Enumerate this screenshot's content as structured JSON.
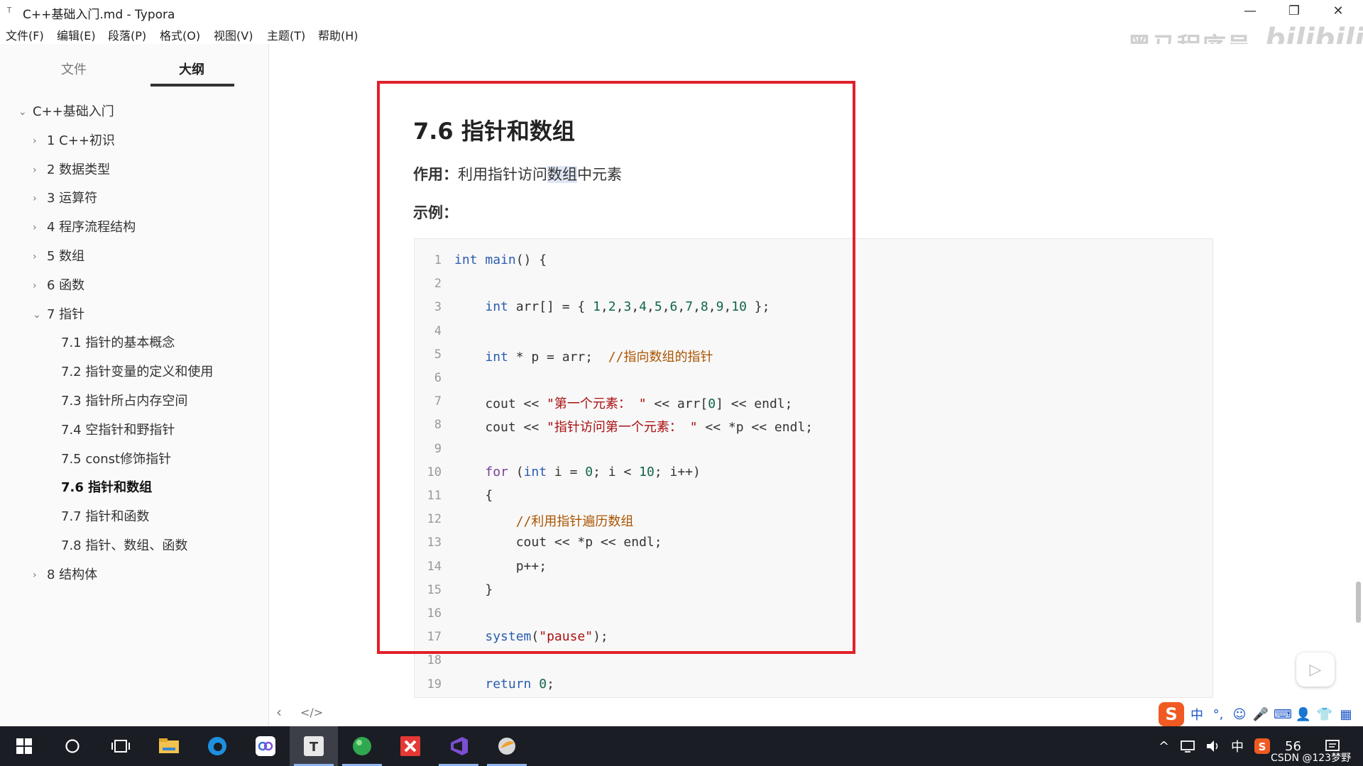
{
  "window": {
    "app_icon": "T",
    "title": "C++基础入门.md - Typora",
    "minimize": "—",
    "maximize": "❐",
    "close": "✕"
  },
  "menu": [
    "文件(F)",
    "编辑(E)",
    "段落(P)",
    "格式(O)",
    "视图(V)",
    "主题(T)",
    "帮助(H)"
  ],
  "watermark": {
    "text": "黑马程序员-",
    "logo": "bilibili"
  },
  "sidebar": {
    "tabs": [
      "文件",
      "大纲"
    ],
    "active_tab": "大纲",
    "outline": [
      {
        "label": "C++基础入门",
        "caret": "⌄",
        "level": 0
      },
      {
        "label": "1 C++初识",
        "caret": "›",
        "level": 1
      },
      {
        "label": "2 数据类型",
        "caret": "›",
        "level": 1
      },
      {
        "label": "3 运算符",
        "caret": "›",
        "level": 1
      },
      {
        "label": "4 程序流程结构",
        "caret": "›",
        "level": 1
      },
      {
        "label": "5 数组",
        "caret": "›",
        "level": 1
      },
      {
        "label": "6 函数",
        "caret": "›",
        "level": 1
      },
      {
        "label": "7 指针",
        "caret": "⌄",
        "level": 1
      },
      {
        "label": "7.1 指针的基本概念",
        "caret": "",
        "level": 2
      },
      {
        "label": "7.2 指针变量的定义和使用",
        "caret": "",
        "level": 2
      },
      {
        "label": "7.3 指针所占内存空间",
        "caret": "",
        "level": 2
      },
      {
        "label": "7.4 空指针和野指针",
        "caret": "",
        "level": 2
      },
      {
        "label": "7.5 const修饰指针",
        "caret": "",
        "level": 2
      },
      {
        "label": "7.6 指针和数组",
        "caret": "",
        "level": 2,
        "active": true
      },
      {
        "label": "7.7 指针和函数",
        "caret": "",
        "level": 2
      },
      {
        "label": "7.8 指针、数组、函数",
        "caret": "",
        "level": 2
      },
      {
        "label": "8 结构体",
        "caret": "›",
        "level": 1
      }
    ]
  },
  "document": {
    "heading": "7.6 指针和数组",
    "purpose_label": "作用：",
    "purpose_text_a": "利用指针访问",
    "purpose_text_sel": "数组",
    "purpose_text_b": "中元素",
    "example_label": "示例：",
    "code_lines": [
      "int main() {",
      "",
      "    int arr[] = { 1,2,3,4,5,6,7,8,9,10 };",
      "",
      "    int * p = arr;  //指向数组的指针",
      "",
      "    cout << \"第一个元素： \" << arr[0] << endl;",
      "    cout << \"指针访问第一个元素： \" << *p << endl;",
      "",
      "    for (int i = 0; i < 10; i++)",
      "    {",
      "        //利用指针遍历数组",
      "        cout << *p << endl;",
      "        p++;",
      "    }",
      "",
      "    system(\"pause\");",
      "",
      "    return 0;"
    ]
  },
  "bottom_bar": {
    "back": "‹",
    "source": "</>"
  },
  "ime": {
    "logo": "S",
    "icons": [
      "中",
      "°,",
      "☺",
      "🎤",
      "⌨",
      "👤",
      "👕",
      "▦"
    ]
  },
  "taskbar": {
    "items": [
      "start-icon",
      "search-icon",
      "task-view-icon",
      "file-explorer-icon",
      "browser-icon",
      "app-icon",
      "typora-icon",
      "green-ball-icon",
      "xmind-icon",
      "visual-studio-icon",
      "bird-icon"
    ],
    "tray": {
      "caret": "^",
      "lang": "中",
      "number": "56",
      "credit": "CSDN @123梦野"
    }
  },
  "colors": {
    "highlight_box": "#e0202a",
    "taskbar": "#1a1d23",
    "accent": "#8cb4f0"
  }
}
